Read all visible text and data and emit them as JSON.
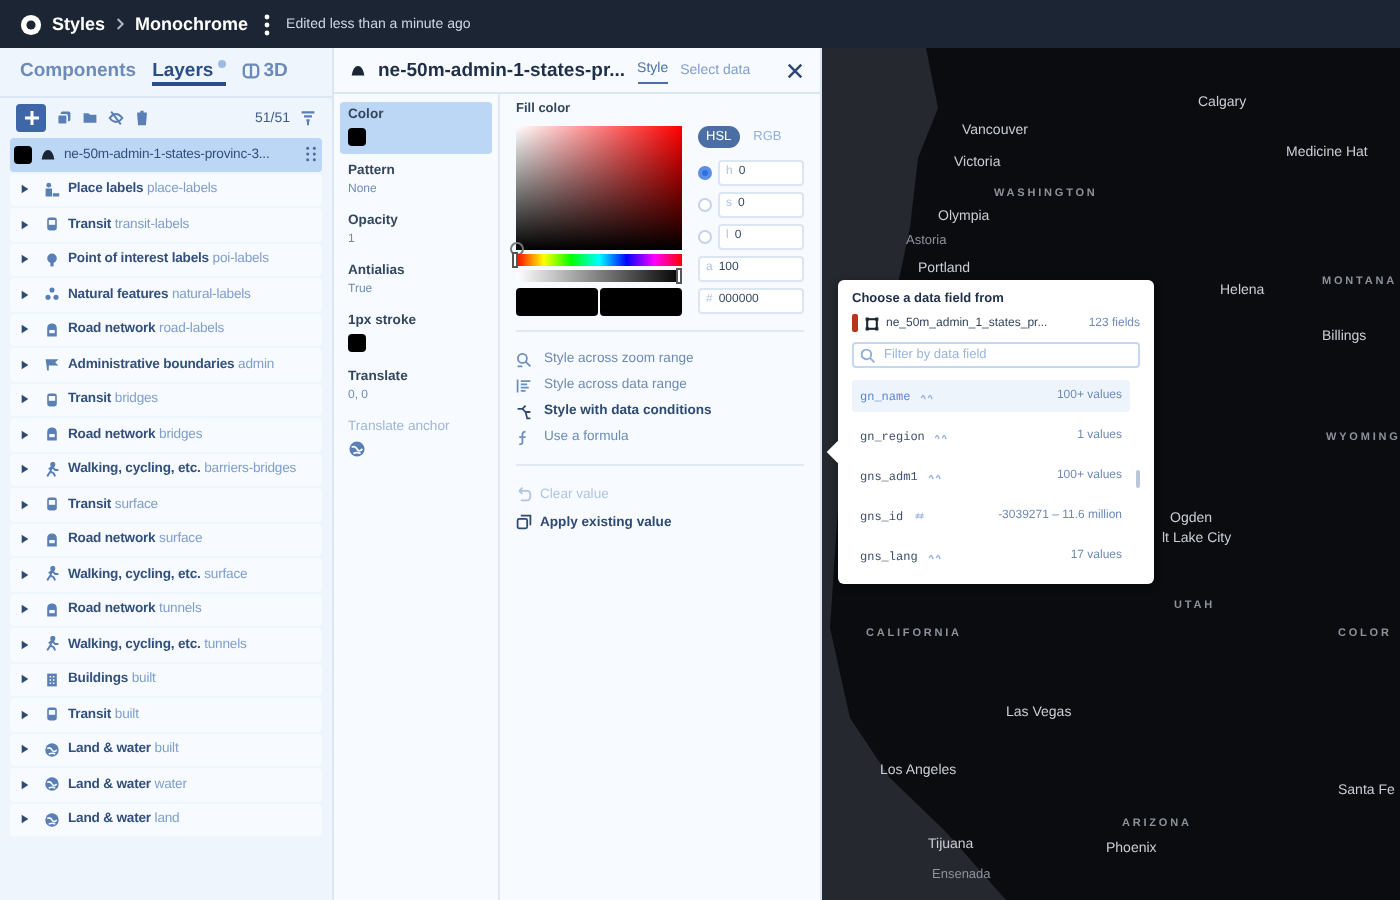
{
  "top_bar": {
    "breadcrumb": [
      "Styles",
      "Monochrome"
    ],
    "status": "Edited less than a minute ago"
  },
  "sidebar": {
    "tabs": [
      {
        "label": "Components",
        "selected": false,
        "badge": false
      },
      {
        "label": "Layers",
        "selected": true,
        "badge": true
      },
      {
        "label": "3D",
        "selected": false,
        "badge": false
      }
    ],
    "count": "51/51",
    "selected_layer": {
      "name": "ne-50m-admin-1-states-provinc-3...",
      "selected": true
    },
    "layers": [
      {
        "group": "Place labels",
        "id": "place-labels",
        "kind": "label",
        "expanded": false
      },
      {
        "group": "Transit",
        "id": "transit-labels",
        "kind": "transit",
        "expanded": false
      },
      {
        "group": "Point of interest labels",
        "id": "poi-labels",
        "kind": "poi",
        "expanded": false
      },
      {
        "group": "Natural features",
        "id": "natural-labels",
        "kind": "natural",
        "expanded": false
      },
      {
        "group": "Road network",
        "id": "road-labels",
        "kind": "road",
        "expanded": false
      },
      {
        "group": "Administrative boundaries",
        "id": "admin",
        "kind": "admin",
        "expanded": false
      },
      {
        "group": "Transit",
        "id": "bridges",
        "kind": "transit",
        "expanded": false
      },
      {
        "group": "Road network",
        "id": "bridges",
        "kind": "road",
        "expanded": false
      },
      {
        "group": "Walking, cycling, etc.",
        "id": "barriers-bridges",
        "kind": "walk",
        "expanded": false
      },
      {
        "group": "Transit",
        "id": "surface",
        "kind": "transit",
        "expanded": false
      },
      {
        "group": "Road network",
        "id": "surface",
        "kind": "road",
        "expanded": false
      },
      {
        "group": "Walking, cycling, etc.",
        "id": "surface",
        "kind": "walk",
        "expanded": false
      },
      {
        "group": "Road network",
        "id": "tunnels",
        "kind": "road",
        "expanded": false
      },
      {
        "group": "Walking, cycling, etc.",
        "id": "tunnels",
        "kind": "walk",
        "expanded": false
      },
      {
        "group": "Buildings",
        "id": "built",
        "kind": "building",
        "expanded": false
      },
      {
        "group": "Transit",
        "id": "built",
        "kind": "transit",
        "expanded": false
      },
      {
        "group": "Land & water",
        "id": "built",
        "kind": "globe",
        "expanded": false
      },
      {
        "group": "Land & water",
        "id": "water",
        "kind": "globe",
        "expanded": false
      },
      {
        "group": "Land & water",
        "id": "land",
        "kind": "globe",
        "expanded": false
      }
    ]
  },
  "editor": {
    "title": "ne-50m-admin-1-states-pr...",
    "tabs": [
      {
        "label": "Style",
        "selected": true
      },
      {
        "label": "Select data",
        "selected": false
      }
    ],
    "properties": [
      {
        "label": "Color",
        "kind": "swatch",
        "color": "#000000",
        "selected": true,
        "disabled": false
      },
      {
        "label": "Pattern",
        "kind": "text",
        "value": "None",
        "selected": false,
        "disabled": false
      },
      {
        "label": "Opacity",
        "kind": "text",
        "value": "1",
        "selected": false,
        "disabled": false
      },
      {
        "label": "Antialias",
        "kind": "text",
        "value": "True",
        "selected": false,
        "disabled": false
      },
      {
        "label": "1px stroke",
        "kind": "swatch",
        "color": "#000000",
        "selected": false,
        "disabled": false
      },
      {
        "label": "Translate",
        "kind": "text",
        "value": "0, 0",
        "selected": false,
        "disabled": false
      },
      {
        "label": "Translate anchor",
        "kind": "globe",
        "selected": false,
        "disabled": true
      }
    ],
    "fill_color": {
      "label": "Fill color",
      "modes": [
        {
          "label": "HSL",
          "selected": true
        },
        {
          "label": "RGB",
          "selected": false
        }
      ],
      "hue": {
        "level": 0
      },
      "alpha": {
        "level": 1
      },
      "channels": [
        {
          "kind": "radio",
          "label": "h",
          "value": "0",
          "selected": true
        },
        {
          "kind": "radio",
          "label": "s",
          "value": "0",
          "selected": false
        },
        {
          "kind": "radio",
          "label": "l",
          "value": "0",
          "selected": false
        },
        {
          "kind": "plain",
          "label": "a",
          "value": "100"
        },
        {
          "kind": "plain",
          "label": "#",
          "value": "000000"
        }
      ]
    },
    "actions": [
      {
        "label": "Style across zoom range",
        "kind": "zoom",
        "emphasis": false
      },
      {
        "label": "Style across data range",
        "kind": "range",
        "emphasis": false
      },
      {
        "label": "Style with data conditions",
        "kind": "conditions",
        "emphasis": true
      },
      {
        "label": "Use a formula",
        "kind": "formula",
        "emphasis": false
      }
    ],
    "footer_actions": [
      {
        "label": "Clear value",
        "kind": "undo",
        "disabled": true
      },
      {
        "label": "Apply existing value",
        "kind": "copy",
        "disabled": false
      }
    ]
  },
  "data_popup": {
    "title": "Choose a data field from",
    "source": {
      "name": "ne_50m_admin_1_states_pr...",
      "count": "123 fields"
    },
    "search": {
      "placeholder": "Filter by data field"
    },
    "fields": [
      {
        "name": "gn_name",
        "kind": "string",
        "summary": "100+ values",
        "selected": true
      },
      {
        "name": "gn_region",
        "kind": "string",
        "summary": "1 values",
        "selected": false
      },
      {
        "name": "gns_adm1",
        "kind": "string",
        "summary": "100+ values",
        "selected": false
      },
      {
        "name": "gns_id",
        "kind": "number",
        "summary": "-3039271 – 11.6 million",
        "selected": false
      },
      {
        "name": "gns_lang",
        "kind": "string",
        "summary": "17 values",
        "selected": false
      }
    ]
  },
  "map": {
    "labels": [
      {
        "text": "Calgary",
        "kind": "city"
      },
      {
        "text": "Vancouver",
        "kind": "city"
      },
      {
        "text": "Victoria",
        "kind": "city"
      },
      {
        "text": "WASHINGTON",
        "kind": "region"
      },
      {
        "text": "Olympia",
        "kind": "city"
      },
      {
        "text": "Astoria",
        "kind": "town"
      },
      {
        "text": "Portland",
        "kind": "city"
      },
      {
        "text": "Medicine Hat",
        "kind": "city"
      },
      {
        "text": "Helena",
        "kind": "city"
      },
      {
        "text": "MONTANA",
        "kind": "region"
      },
      {
        "text": "Billings",
        "kind": "city"
      },
      {
        "text": "WYOMING",
        "kind": "region"
      },
      {
        "text": "Ogden",
        "kind": "city"
      },
      {
        "text": "lt Lake City",
        "kind": "city"
      },
      {
        "text": "UTAH",
        "kind": "region"
      },
      {
        "text": "CALIFORNIA",
        "kind": "region"
      },
      {
        "text": "COLOR",
        "kind": "region"
      },
      {
        "text": "Las Vegas",
        "kind": "city"
      },
      {
        "text": "Los Angeles",
        "kind": "city"
      },
      {
        "text": "Santa Fe",
        "kind": "city"
      },
      {
        "text": "ARIZONA",
        "kind": "region"
      },
      {
        "text": "Tijuana",
        "kind": "city"
      },
      {
        "text": "Phoenix",
        "kind": "city"
      },
      {
        "text": "Ensenada",
        "kind": "town"
      }
    ]
  }
}
